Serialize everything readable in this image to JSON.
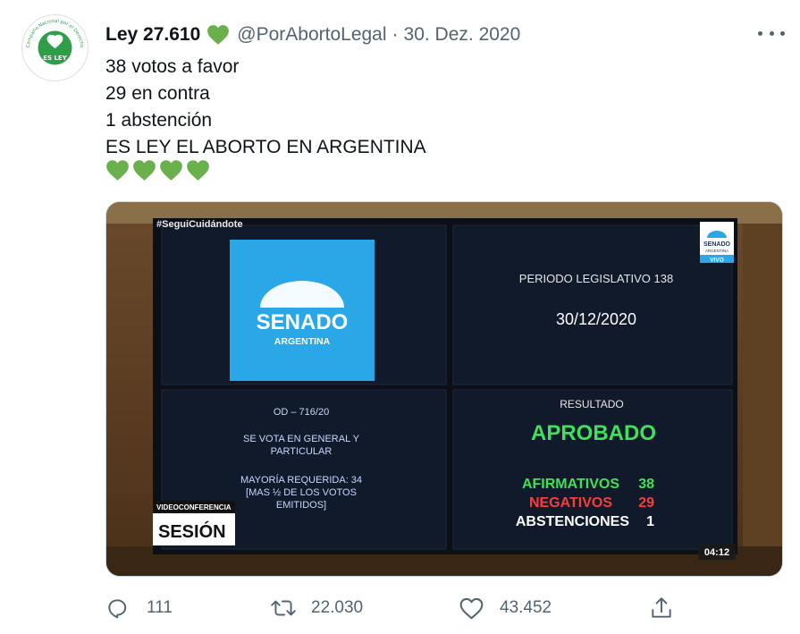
{
  "tweet": {
    "display_name": "Ley 27.610",
    "handle": "@PorAbortoLegal",
    "separator": "·",
    "date": "30. Dez. 2020",
    "avatar": {
      "arc_text": "Campaña Nacional por el Derecho al Aborto Legal, Seguro y Gratuito",
      "center_text": "ES LEY"
    },
    "lines": [
      "38 votos a favor",
      "29 en contra",
      "1 abstención",
      "ES LEY EL ABORTO EN ARGENTINA"
    ],
    "emoji_hearts": 4,
    "heart_color": "#6ab04c"
  },
  "media": {
    "hashtag": "#SeguiCuidándote",
    "logo_title": "SENADO",
    "logo_subtitle": "ARGENTINA",
    "period": "PERIODO LEGISLATIVO 138",
    "date": "30/12/2020",
    "od": "OD – 716/20",
    "vote_line1": "SE VOTA EN GENERAL Y",
    "vote_line2": "PARTICULAR",
    "majority_line1": "MAYORÍA REQUERIDA: 34",
    "majority_line2": "[MAS ½ DE LOS VOTOS",
    "majority_line3": "EMITIDOS]",
    "result_label": "RESULTADO",
    "result": "APROBADO",
    "afirmativos_label": "AFIRMATIVOS",
    "afirmativos_value": "38",
    "negativos_label": "NEGATIVOS",
    "negativos_value": "29",
    "abstenciones_label": "ABSTENCIONES",
    "abstenciones_value": "1",
    "badge_line1": "SENADO",
    "badge_line2": "ARGENTINA",
    "badge_live": "VIVO",
    "overlay_top": "VIDEOCONFERENCIA",
    "overlay_main": "SESIÓN",
    "timestamp": "04:12"
  },
  "actions": {
    "reply_count": "111",
    "retweet_count": "22.030",
    "like_count": "43.452"
  }
}
